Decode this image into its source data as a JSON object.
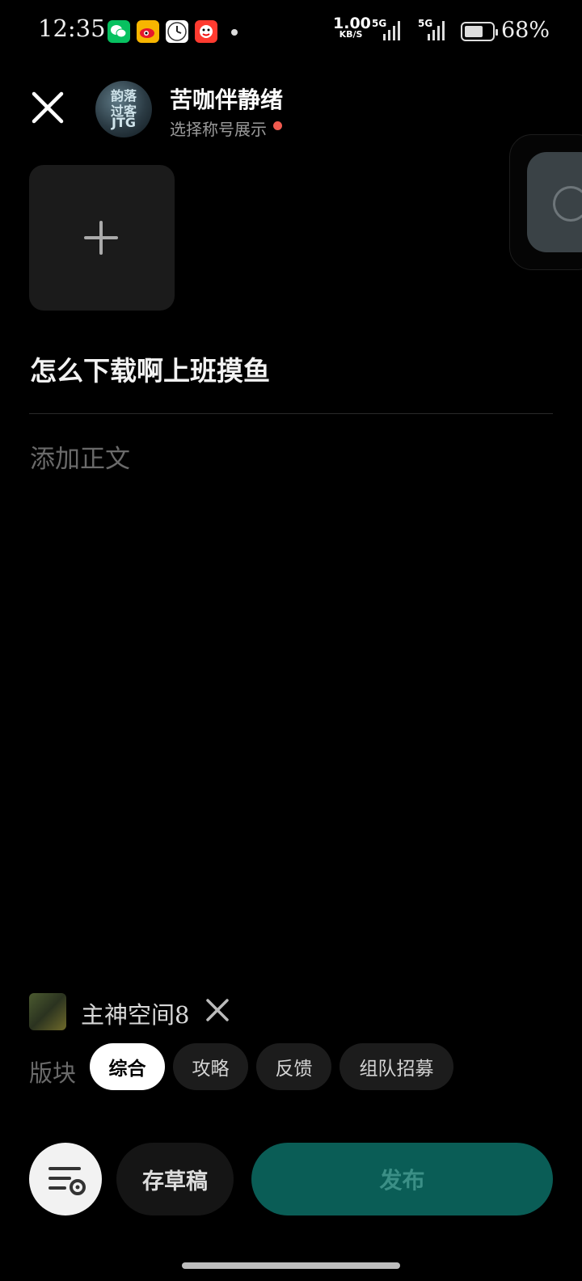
{
  "status_bar": {
    "time": "12:35",
    "net_speed_value": "1.00",
    "net_speed_unit": "KB/S",
    "sim1_label": "5G",
    "sim2_label": "5G",
    "battery_percent": "68%",
    "battery_level": 0.68,
    "notification_icons": [
      "wechat-icon",
      "weibo-icon",
      "clock-app-icon",
      "game-app-icon"
    ]
  },
  "header": {
    "avatar_text_top": "韵落",
    "avatar_text_mid": "过客",
    "avatar_text_bottom": "JTG",
    "username": "苦咖伴静绪",
    "subtitle": "选择称号展示"
  },
  "editor": {
    "title": "怎么下载啊上班摸鱼",
    "body_placeholder": "添加正文"
  },
  "channel": {
    "name": "主神空间8"
  },
  "sections": {
    "label": "版块",
    "items": [
      {
        "label": "综合",
        "active": true
      },
      {
        "label": "攻略",
        "active": false
      },
      {
        "label": "反馈",
        "active": false
      },
      {
        "label": "组队招募",
        "active": false
      }
    ]
  },
  "actions": {
    "draft_label": "存草稿",
    "publish_label": "发布"
  },
  "colors": {
    "background": "#000000",
    "publish_bg": "#0a5d56",
    "publish_text": "#3b8f86",
    "notify_dot": "#f05a4f"
  }
}
